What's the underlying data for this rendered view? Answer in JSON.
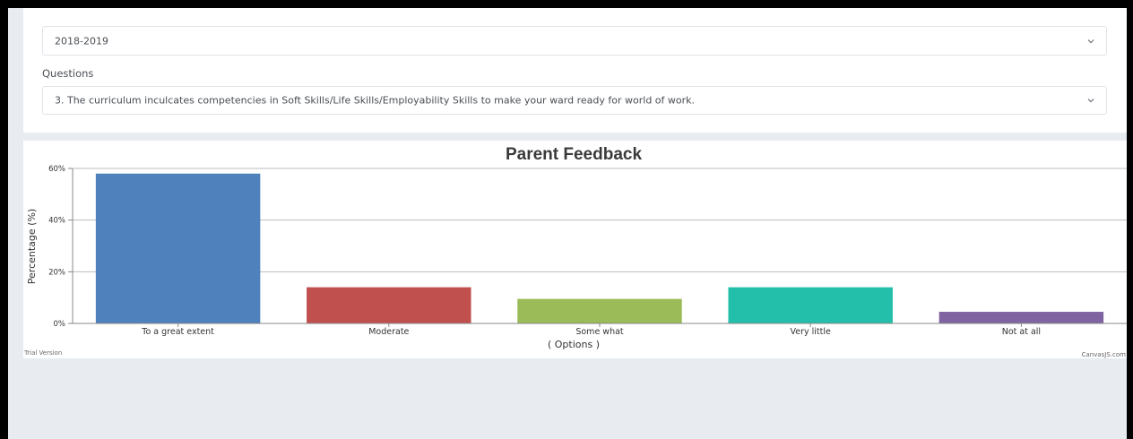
{
  "filters": {
    "year_value": "2018-2019",
    "questions_label": "Questions",
    "question_value": "3. The curriculum inculcates competencies in Soft Skills/Life Skills/Employability Skills to make your ward ready for world of work."
  },
  "chart_data": {
    "type": "bar",
    "title": "Parent Feedback",
    "xlabel": "( Options )",
    "ylabel": "Percentage (%)",
    "ylim": [
      0,
      60
    ],
    "yticks": [
      "0%",
      "20%",
      "40%",
      "60%"
    ],
    "grid": true,
    "categories": [
      "To a great extent",
      "Moderate",
      "Some what",
      "Very little",
      "Not at all"
    ],
    "values": [
      58,
      14,
      9.5,
      14,
      4.5
    ],
    "colors": [
      "#4f81bc",
      "#c0504e",
      "#9bbb58",
      "#23bfaa",
      "#8064a1"
    ],
    "watermark_left": "Trial Version",
    "watermark_right": "CanvasJS.com"
  }
}
